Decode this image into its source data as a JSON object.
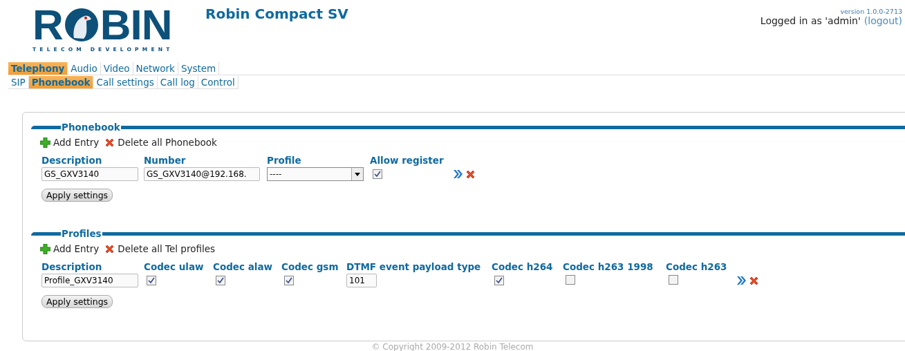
{
  "logo": {
    "letters_before": "R",
    "letters_after": "BIN",
    "tagline": "TELECOM DEVELOPMENT"
  },
  "product_title": "Robin Compact SV",
  "version": "version 1.0.0-2713",
  "login": {
    "text": "Logged in as 'admin'",
    "logout": "(logout)"
  },
  "main_tabs": [
    {
      "label": "Telephony",
      "selected": true
    },
    {
      "label": "Audio",
      "selected": false
    },
    {
      "label": "Video",
      "selected": false
    },
    {
      "label": "Network",
      "selected": false
    },
    {
      "label": "System",
      "selected": false
    }
  ],
  "sub_tabs": [
    {
      "label": "SIP",
      "selected": false
    },
    {
      "label": "Phonebook",
      "selected": true
    },
    {
      "label": "Call settings",
      "selected": false
    },
    {
      "label": "Call log",
      "selected": false
    },
    {
      "label": "Control",
      "selected": false
    }
  ],
  "sections": [
    {
      "title": "Phonebook",
      "add": "Add Entry",
      "delete_all": "Delete all Phonebook",
      "columns": [
        "Description",
        "Number",
        "Profile",
        "Allow register"
      ],
      "rows": [
        {
          "cells": [
            {
              "kind": "text",
              "value": "GS_GXV3140"
            },
            {
              "kind": "text",
              "value": "GS_GXV3140@192.168."
            },
            {
              "kind": "select",
              "value": "----"
            },
            {
              "kind": "checkbox",
              "checked": true
            }
          ]
        }
      ],
      "apply": "Apply settings"
    },
    {
      "title": "Profiles",
      "add": "Add Entry",
      "delete_all": "Delete all Tel profiles",
      "columns": [
        "Description",
        "Codec ulaw",
        "Codec alaw",
        "Codec gsm",
        "DTMF event payload type",
        "Codec h264",
        "Codec h263 1998",
        "Codec h263"
      ],
      "rows": [
        {
          "cells": [
            {
              "kind": "text",
              "value": "Profile_GXV3140"
            },
            {
              "kind": "checkbox",
              "checked": true
            },
            {
              "kind": "checkbox",
              "checked": true
            },
            {
              "kind": "checkbox",
              "checked": true
            },
            {
              "kind": "short",
              "value": "101"
            },
            {
              "kind": "checkbox",
              "checked": true
            },
            {
              "kind": "checkbox",
              "checked": false
            },
            {
              "kind": "checkbox",
              "checked": false
            }
          ]
        }
      ],
      "apply": "Apply settings"
    }
  ],
  "copyright": "© Copyright 2009-2012 Robin Telecom"
}
